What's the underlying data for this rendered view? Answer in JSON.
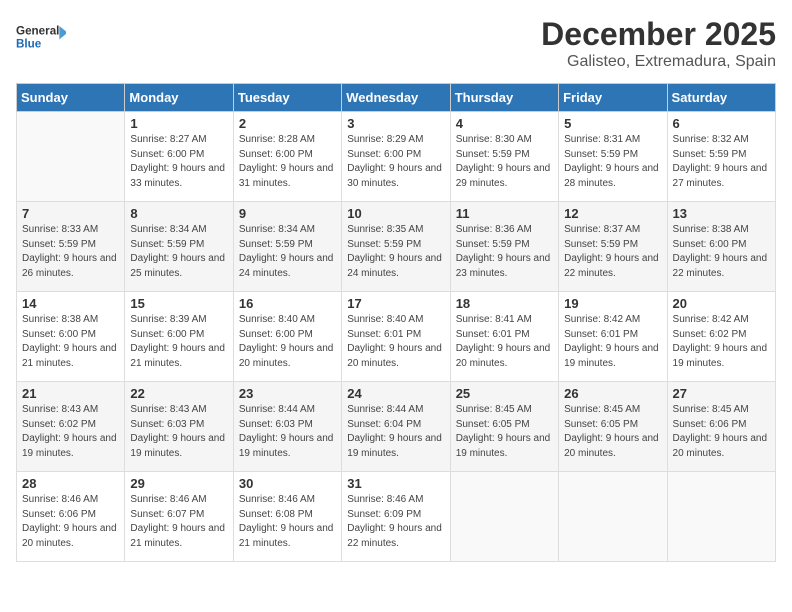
{
  "header": {
    "logo_line1": "General",
    "logo_line2": "Blue",
    "month": "December 2025",
    "location": "Galisteo, Extremadura, Spain"
  },
  "weekdays": [
    "Sunday",
    "Monday",
    "Tuesday",
    "Wednesday",
    "Thursday",
    "Friday",
    "Saturday"
  ],
  "weeks": [
    [
      {
        "day": "",
        "sunrise": "",
        "sunset": "",
        "daylight": ""
      },
      {
        "day": "1",
        "sunrise": "8:27 AM",
        "sunset": "6:00 PM",
        "daylight": "9 hours and 33 minutes."
      },
      {
        "day": "2",
        "sunrise": "8:28 AM",
        "sunset": "6:00 PM",
        "daylight": "9 hours and 31 minutes."
      },
      {
        "day": "3",
        "sunrise": "8:29 AM",
        "sunset": "6:00 PM",
        "daylight": "9 hours and 30 minutes."
      },
      {
        "day": "4",
        "sunrise": "8:30 AM",
        "sunset": "5:59 PM",
        "daylight": "9 hours and 29 minutes."
      },
      {
        "day": "5",
        "sunrise": "8:31 AM",
        "sunset": "5:59 PM",
        "daylight": "9 hours and 28 minutes."
      },
      {
        "day": "6",
        "sunrise": "8:32 AM",
        "sunset": "5:59 PM",
        "daylight": "9 hours and 27 minutes."
      }
    ],
    [
      {
        "day": "7",
        "sunrise": "8:33 AM",
        "sunset": "5:59 PM",
        "daylight": "9 hours and 26 minutes."
      },
      {
        "day": "8",
        "sunrise": "8:34 AM",
        "sunset": "5:59 PM",
        "daylight": "9 hours and 25 minutes."
      },
      {
        "day": "9",
        "sunrise": "8:34 AM",
        "sunset": "5:59 PM",
        "daylight": "9 hours and 24 minutes."
      },
      {
        "day": "10",
        "sunrise": "8:35 AM",
        "sunset": "5:59 PM",
        "daylight": "9 hours and 24 minutes."
      },
      {
        "day": "11",
        "sunrise": "8:36 AM",
        "sunset": "5:59 PM",
        "daylight": "9 hours and 23 minutes."
      },
      {
        "day": "12",
        "sunrise": "8:37 AM",
        "sunset": "5:59 PM",
        "daylight": "9 hours and 22 minutes."
      },
      {
        "day": "13",
        "sunrise": "8:38 AM",
        "sunset": "6:00 PM",
        "daylight": "9 hours and 22 minutes."
      }
    ],
    [
      {
        "day": "14",
        "sunrise": "8:38 AM",
        "sunset": "6:00 PM",
        "daylight": "9 hours and 21 minutes."
      },
      {
        "day": "15",
        "sunrise": "8:39 AM",
        "sunset": "6:00 PM",
        "daylight": "9 hours and 21 minutes."
      },
      {
        "day": "16",
        "sunrise": "8:40 AM",
        "sunset": "6:00 PM",
        "daylight": "9 hours and 20 minutes."
      },
      {
        "day": "17",
        "sunrise": "8:40 AM",
        "sunset": "6:01 PM",
        "daylight": "9 hours and 20 minutes."
      },
      {
        "day": "18",
        "sunrise": "8:41 AM",
        "sunset": "6:01 PM",
        "daylight": "9 hours and 20 minutes."
      },
      {
        "day": "19",
        "sunrise": "8:42 AM",
        "sunset": "6:01 PM",
        "daylight": "9 hours and 19 minutes."
      },
      {
        "day": "20",
        "sunrise": "8:42 AM",
        "sunset": "6:02 PM",
        "daylight": "9 hours and 19 minutes."
      }
    ],
    [
      {
        "day": "21",
        "sunrise": "8:43 AM",
        "sunset": "6:02 PM",
        "daylight": "9 hours and 19 minutes."
      },
      {
        "day": "22",
        "sunrise": "8:43 AM",
        "sunset": "6:03 PM",
        "daylight": "9 hours and 19 minutes."
      },
      {
        "day": "23",
        "sunrise": "8:44 AM",
        "sunset": "6:03 PM",
        "daylight": "9 hours and 19 minutes."
      },
      {
        "day": "24",
        "sunrise": "8:44 AM",
        "sunset": "6:04 PM",
        "daylight": "9 hours and 19 minutes."
      },
      {
        "day": "25",
        "sunrise": "8:45 AM",
        "sunset": "6:05 PM",
        "daylight": "9 hours and 19 minutes."
      },
      {
        "day": "26",
        "sunrise": "8:45 AM",
        "sunset": "6:05 PM",
        "daylight": "9 hours and 20 minutes."
      },
      {
        "day": "27",
        "sunrise": "8:45 AM",
        "sunset": "6:06 PM",
        "daylight": "9 hours and 20 minutes."
      }
    ],
    [
      {
        "day": "28",
        "sunrise": "8:46 AM",
        "sunset": "6:06 PM",
        "daylight": "9 hours and 20 minutes."
      },
      {
        "day": "29",
        "sunrise": "8:46 AM",
        "sunset": "6:07 PM",
        "daylight": "9 hours and 21 minutes."
      },
      {
        "day": "30",
        "sunrise": "8:46 AM",
        "sunset": "6:08 PM",
        "daylight": "9 hours and 21 minutes."
      },
      {
        "day": "31",
        "sunrise": "8:46 AM",
        "sunset": "6:09 PM",
        "daylight": "9 hours and 22 minutes."
      },
      {
        "day": "",
        "sunrise": "",
        "sunset": "",
        "daylight": ""
      },
      {
        "day": "",
        "sunrise": "",
        "sunset": "",
        "daylight": ""
      },
      {
        "day": "",
        "sunrise": "",
        "sunset": "",
        "daylight": ""
      }
    ]
  ]
}
